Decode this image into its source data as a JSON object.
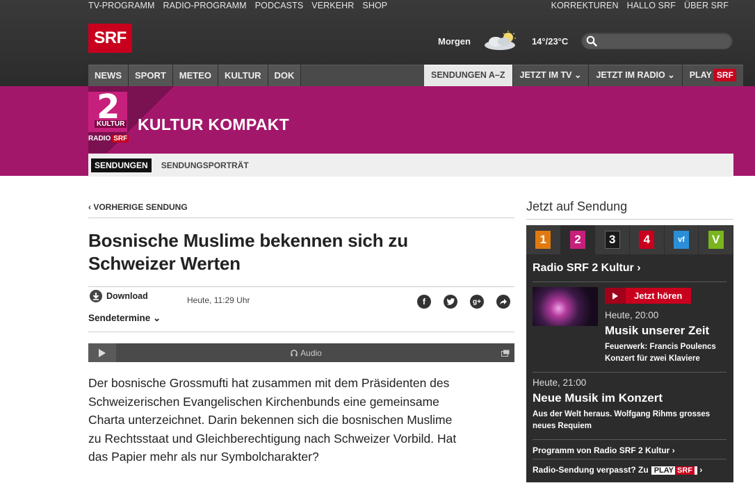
{
  "utility_nav": {
    "left": [
      "TV-PROGRAMM",
      "RADIO-PROGRAMM",
      "PODCASTS",
      "VERKEHR",
      "SHOP"
    ],
    "right": [
      "KORREKTUREN",
      "HALLO SRF",
      "ÜBER SRF"
    ]
  },
  "logo_text": "SRF",
  "weather": {
    "label": "Morgen",
    "temp": "14°/23°C"
  },
  "search": {
    "placeholder": ""
  },
  "main_nav": [
    "NEWS",
    "SPORT",
    "METEO",
    "KULTUR",
    "DOK"
  ],
  "right_nav": {
    "sendungen": "SENDUNGEN A–Z",
    "tv": "JETZT IM TV ⌄",
    "radio": "JETZT IM RADIO ⌄",
    "play": "PLAY",
    "play_badge": "SRF"
  },
  "show": {
    "logo_num": "2",
    "logo_kultur": "KULTUR",
    "logo_radio": "RADIO",
    "logo_srf": "SRF",
    "title": "KULTUR KOMPAKT",
    "tabs": [
      "SENDUNGEN",
      "SENDUNGSPORTRÄT"
    ]
  },
  "article": {
    "prev": "‹  VORHERIGE SENDUNG",
    "headline": "Bosnische Muslime bekennen sich zu Schweizer Werten",
    "download": "Download",
    "sendetermine": "Sendetermine ⌄",
    "date": "Heute, 11:29 Uhr",
    "player_label": "Audio",
    "lead": "Der bosnische Grossmufti hat zusammen mit dem Präsidenten des Schweizerischen Evangelischen Kirchenbunds eine gemeinsame Charta unterzeichnet. Darin bekennen sich die bosnischen Muslime zu Rechtsstaat und Gleichberechtigung nach Schweizer Vorbild. Hat das Papier mehr als nur Symbolcharakter?"
  },
  "sidebar": {
    "title": "Jetzt auf Sendung",
    "channels": [
      "1",
      "2",
      "3",
      "4",
      "vf",
      "V"
    ],
    "channel_colors": [
      "#e07a10",
      "#c7207c",
      "#1a1a1a",
      "#c8001e",
      "#2a8fd8",
      "#7ab51d"
    ],
    "station": "Radio SRF 2 Kultur ›",
    "listen": "Jetzt hören",
    "now": {
      "time": "Heute, 20:00",
      "title": "Musik unserer Zeit",
      "desc": "Feuerwerk: Francis Poulencs Konzert für zwei Klaviere"
    },
    "next": {
      "time": "Heute, 21:00",
      "title": "Neue Musik im Konzert",
      "desc": "Aus der Welt heraus. Wolfgang Rihms grosses neues Requiem"
    },
    "link_programm": "Programm von Radio SRF 2 Kultur ›",
    "link_missed": "Radio-Sendung verpasst? Zu",
    "link_play": "PLAY",
    "link_srf": "SRF",
    "link_arrow": "›"
  }
}
